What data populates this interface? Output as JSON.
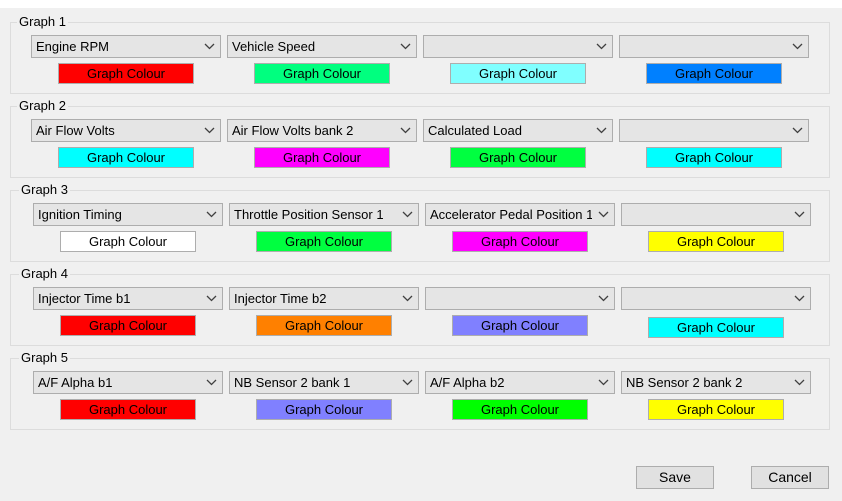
{
  "groups": [
    {
      "title": "Graph 1",
      "selects": [
        "Engine RPM",
        "Vehicle Speed",
        "",
        ""
      ],
      "colour_label": "Graph Colour",
      "colours": [
        "#ff0000",
        "#00ff7f",
        "#80ffff",
        "#0080ff"
      ]
    },
    {
      "title": "Graph 2",
      "selects": [
        "Air Flow Volts",
        "Air Flow Volts bank 2",
        "Calculated Load",
        ""
      ],
      "colour_label": "Graph Colour",
      "colours": [
        "#00ffff",
        "#ff00ff",
        "#00ff40",
        "#00ffff"
      ]
    },
    {
      "title": "Graph 3",
      "selects": [
        "Ignition Timing",
        "Throttle Position Sensor 1",
        "Accelerator Pedal Position 1",
        ""
      ],
      "colour_label": "Graph Colour",
      "colours": [
        "#ffffff",
        "#00ff40",
        "#ff00ff",
        "#ffff00"
      ]
    },
    {
      "title": "Graph 4",
      "selects": [
        "Injector Time b1",
        "Injector Time b2",
        "",
        ""
      ],
      "colour_label": "Graph Colour",
      "colours": [
        "#ff0000",
        "#ff8000",
        "#8080ff",
        "#00ffff"
      ]
    },
    {
      "title": "Graph 5",
      "selects": [
        "A/F Alpha b1",
        "NB Sensor 2 bank 1",
        "A/F Alpha b2",
        "NB Sensor 2 bank 2"
      ],
      "colour_label": "Graph Colour",
      "colours": [
        "#ff0000",
        "#8080ff",
        "#00ff00",
        "#ffff00"
      ]
    }
  ],
  "buttons": {
    "save": "Save",
    "cancel": "Cancel"
  },
  "icons": {
    "dropdown": "chevron-down-icon"
  }
}
